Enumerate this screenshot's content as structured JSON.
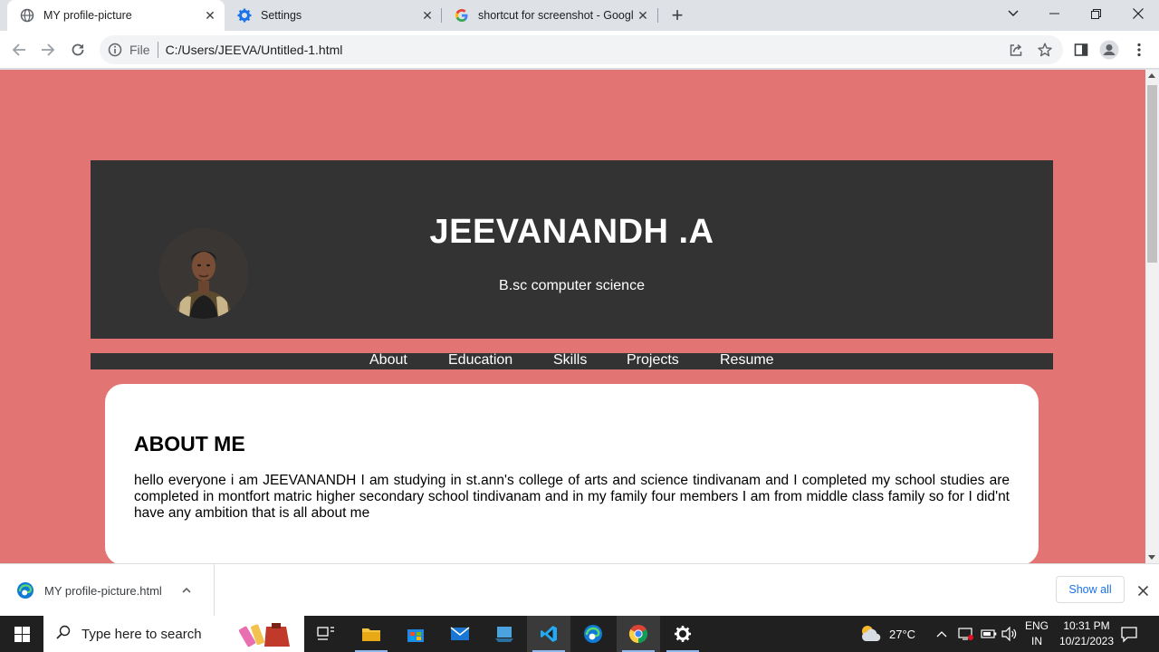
{
  "browser": {
    "tabs": [
      {
        "title": "MY profile-picture",
        "active": true,
        "icon": "globe-icon"
      },
      {
        "title": "Settings",
        "active": false,
        "icon": "gear-icon"
      },
      {
        "title": "shortcut for screenshot - Google",
        "active": false,
        "icon": "google-icon"
      }
    ],
    "address": {
      "scheme_label": "File",
      "url": "C:/Users/JEEVA/Untitled-1.html"
    }
  },
  "page": {
    "background_color": "#e27574",
    "header": {
      "name": "JEEVANANDH .A",
      "subtitle": "B.sc computer science"
    },
    "nav": [
      "About",
      "Education",
      "Skills",
      "Projects",
      "Resume"
    ],
    "about": {
      "heading": "ABOUT ME",
      "text": "hello everyone i am JEEVANANDH I am studying in st.ann's college of arts and science tindivanam and I completed my school studies are completed in montfort matric higher secondary school tindivanam and in my family four members I am from middle class family so for I did'nt have any ambition that is all about me"
    }
  },
  "downloads": {
    "filename": "MY profile-picture.html",
    "show_all": "Show all"
  },
  "taskbar": {
    "search_placeholder": "Type here to search",
    "weather": "27°C",
    "lang_top": "ENG",
    "lang_bottom": "IN",
    "time": "10:31 PM",
    "date": "10/21/2023"
  }
}
